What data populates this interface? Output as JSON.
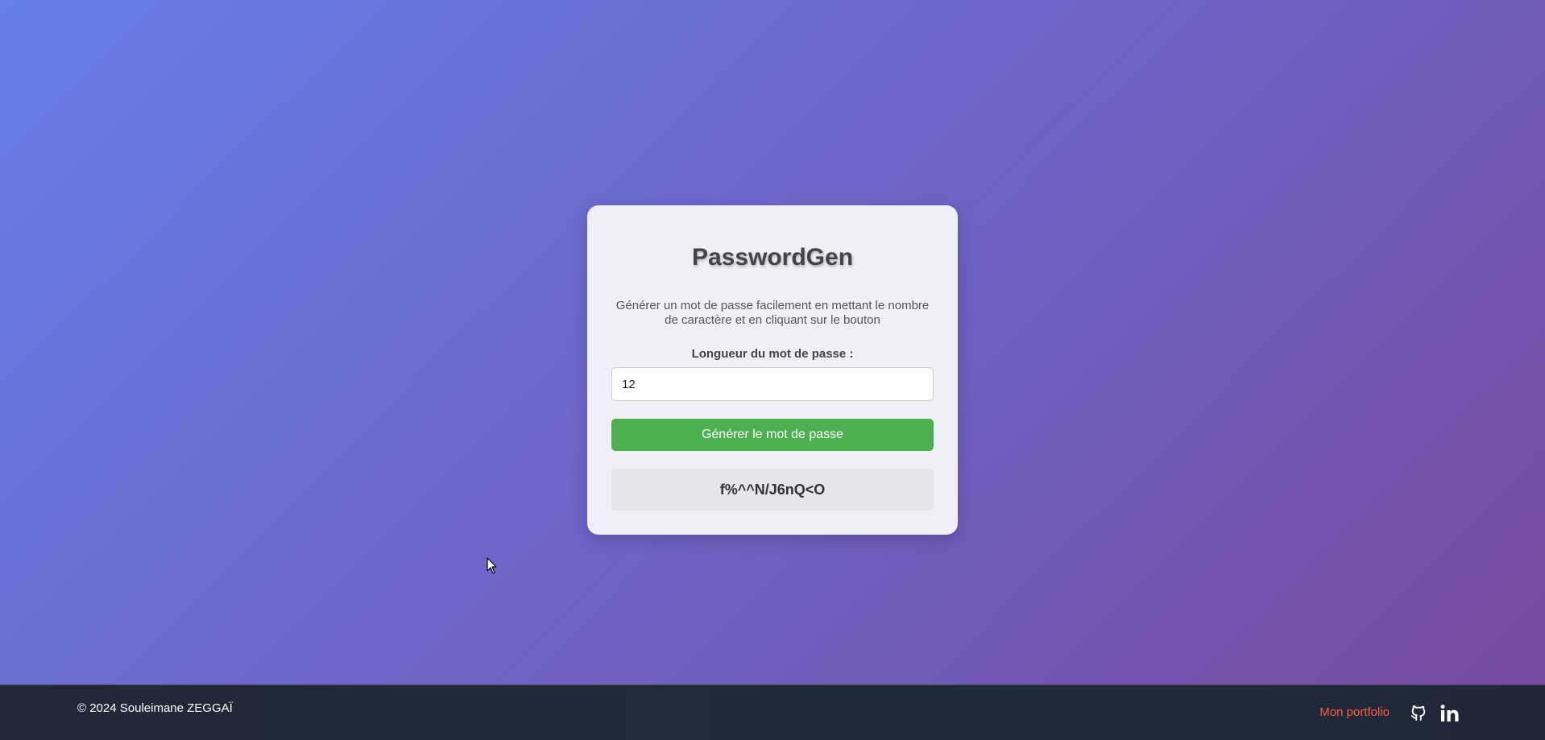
{
  "card": {
    "title": "PasswordGen",
    "description": "Générer un mot de passe facilement en mettant le nombre de caractère et en cliquant sur le bouton",
    "length_label": "Longueur du mot de passe :",
    "length_value": "12",
    "generate_button_label": "Générer le mot de passe",
    "generated_password": "f%^^N/J6nQ<O"
  },
  "footer": {
    "copyright": "© 2024 Souleimane ZEGGAÏ",
    "portfolio_link": "Mon portfolio",
    "icons": [
      "github-icon",
      "linkedin-icon"
    ]
  },
  "colors": {
    "gradient_start": "#667eea",
    "gradient_end": "#764ba2",
    "button": "#4caf50",
    "portfolio_link": "#ff5a3c",
    "footer_bg": "#222838"
  }
}
